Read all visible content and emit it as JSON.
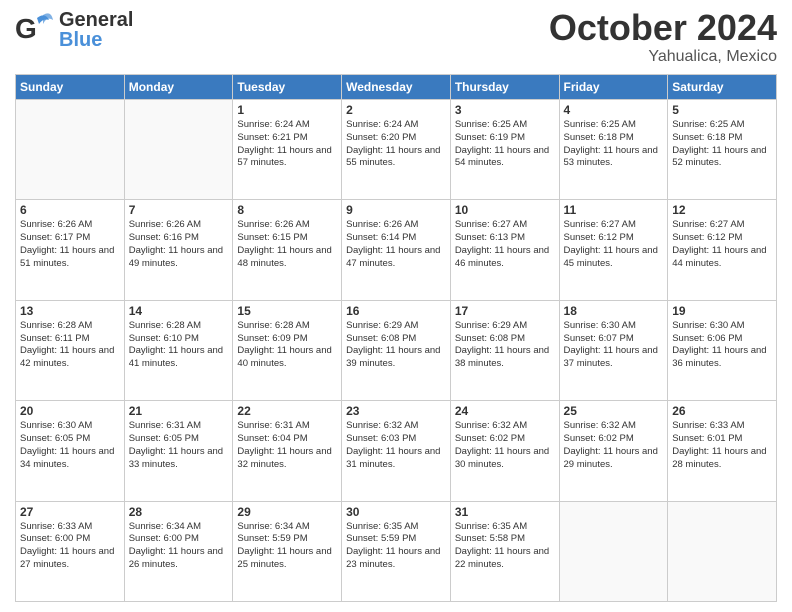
{
  "header": {
    "logo_general": "General",
    "logo_blue": "Blue",
    "month": "October 2024",
    "location": "Yahualica, Mexico"
  },
  "weekdays": [
    "Sunday",
    "Monday",
    "Tuesday",
    "Wednesday",
    "Thursday",
    "Friday",
    "Saturday"
  ],
  "weeks": [
    [
      {
        "day": "",
        "info": ""
      },
      {
        "day": "",
        "info": ""
      },
      {
        "day": "1",
        "info": "Sunrise: 6:24 AM\nSunset: 6:21 PM\nDaylight: 11 hours and 57 minutes."
      },
      {
        "day": "2",
        "info": "Sunrise: 6:24 AM\nSunset: 6:20 PM\nDaylight: 11 hours and 55 minutes."
      },
      {
        "day": "3",
        "info": "Sunrise: 6:25 AM\nSunset: 6:19 PM\nDaylight: 11 hours and 54 minutes."
      },
      {
        "day": "4",
        "info": "Sunrise: 6:25 AM\nSunset: 6:18 PM\nDaylight: 11 hours and 53 minutes."
      },
      {
        "day": "5",
        "info": "Sunrise: 6:25 AM\nSunset: 6:18 PM\nDaylight: 11 hours and 52 minutes."
      }
    ],
    [
      {
        "day": "6",
        "info": "Sunrise: 6:26 AM\nSunset: 6:17 PM\nDaylight: 11 hours and 51 minutes."
      },
      {
        "day": "7",
        "info": "Sunrise: 6:26 AM\nSunset: 6:16 PM\nDaylight: 11 hours and 49 minutes."
      },
      {
        "day": "8",
        "info": "Sunrise: 6:26 AM\nSunset: 6:15 PM\nDaylight: 11 hours and 48 minutes."
      },
      {
        "day": "9",
        "info": "Sunrise: 6:26 AM\nSunset: 6:14 PM\nDaylight: 11 hours and 47 minutes."
      },
      {
        "day": "10",
        "info": "Sunrise: 6:27 AM\nSunset: 6:13 PM\nDaylight: 11 hours and 46 minutes."
      },
      {
        "day": "11",
        "info": "Sunrise: 6:27 AM\nSunset: 6:12 PM\nDaylight: 11 hours and 45 minutes."
      },
      {
        "day": "12",
        "info": "Sunrise: 6:27 AM\nSunset: 6:12 PM\nDaylight: 11 hours and 44 minutes."
      }
    ],
    [
      {
        "day": "13",
        "info": "Sunrise: 6:28 AM\nSunset: 6:11 PM\nDaylight: 11 hours and 42 minutes."
      },
      {
        "day": "14",
        "info": "Sunrise: 6:28 AM\nSunset: 6:10 PM\nDaylight: 11 hours and 41 minutes."
      },
      {
        "day": "15",
        "info": "Sunrise: 6:28 AM\nSunset: 6:09 PM\nDaylight: 11 hours and 40 minutes."
      },
      {
        "day": "16",
        "info": "Sunrise: 6:29 AM\nSunset: 6:08 PM\nDaylight: 11 hours and 39 minutes."
      },
      {
        "day": "17",
        "info": "Sunrise: 6:29 AM\nSunset: 6:08 PM\nDaylight: 11 hours and 38 minutes."
      },
      {
        "day": "18",
        "info": "Sunrise: 6:30 AM\nSunset: 6:07 PM\nDaylight: 11 hours and 37 minutes."
      },
      {
        "day": "19",
        "info": "Sunrise: 6:30 AM\nSunset: 6:06 PM\nDaylight: 11 hours and 36 minutes."
      }
    ],
    [
      {
        "day": "20",
        "info": "Sunrise: 6:30 AM\nSunset: 6:05 PM\nDaylight: 11 hours and 34 minutes."
      },
      {
        "day": "21",
        "info": "Sunrise: 6:31 AM\nSunset: 6:05 PM\nDaylight: 11 hours and 33 minutes."
      },
      {
        "day": "22",
        "info": "Sunrise: 6:31 AM\nSunset: 6:04 PM\nDaylight: 11 hours and 32 minutes."
      },
      {
        "day": "23",
        "info": "Sunrise: 6:32 AM\nSunset: 6:03 PM\nDaylight: 11 hours and 31 minutes."
      },
      {
        "day": "24",
        "info": "Sunrise: 6:32 AM\nSunset: 6:02 PM\nDaylight: 11 hours and 30 minutes."
      },
      {
        "day": "25",
        "info": "Sunrise: 6:32 AM\nSunset: 6:02 PM\nDaylight: 11 hours and 29 minutes."
      },
      {
        "day": "26",
        "info": "Sunrise: 6:33 AM\nSunset: 6:01 PM\nDaylight: 11 hours and 28 minutes."
      }
    ],
    [
      {
        "day": "27",
        "info": "Sunrise: 6:33 AM\nSunset: 6:00 PM\nDaylight: 11 hours and 27 minutes."
      },
      {
        "day": "28",
        "info": "Sunrise: 6:34 AM\nSunset: 6:00 PM\nDaylight: 11 hours and 26 minutes."
      },
      {
        "day": "29",
        "info": "Sunrise: 6:34 AM\nSunset: 5:59 PM\nDaylight: 11 hours and 25 minutes."
      },
      {
        "day": "30",
        "info": "Sunrise: 6:35 AM\nSunset: 5:59 PM\nDaylight: 11 hours and 23 minutes."
      },
      {
        "day": "31",
        "info": "Sunrise: 6:35 AM\nSunset: 5:58 PM\nDaylight: 11 hours and 22 minutes."
      },
      {
        "day": "",
        "info": ""
      },
      {
        "day": "",
        "info": ""
      }
    ]
  ]
}
